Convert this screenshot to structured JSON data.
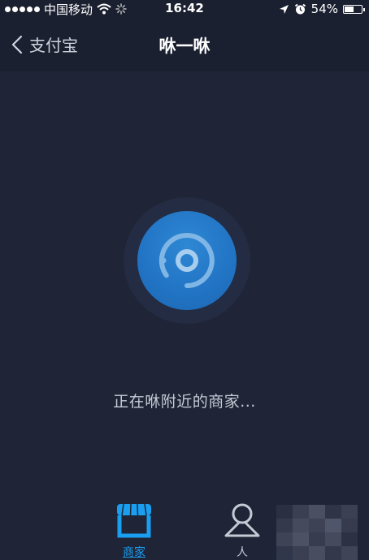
{
  "status_bar": {
    "carrier": "中国移动",
    "time": "16:42",
    "battery": "54%",
    "battery_level": 0.54
  },
  "nav": {
    "back_label": "支付宝",
    "title": "咻一咻"
  },
  "main": {
    "status_text": "正在咻附近的商家..."
  },
  "tabs": [
    {
      "label": "商家",
      "icon": "storefront-icon",
      "active": true
    },
    {
      "label": "人",
      "icon": "person-icon",
      "active": false
    }
  ],
  "colors": {
    "background": "#1f2436",
    "nav_background": "#1b2030",
    "accent": "#1a9ef0",
    "scan_button": "#2173c3"
  }
}
